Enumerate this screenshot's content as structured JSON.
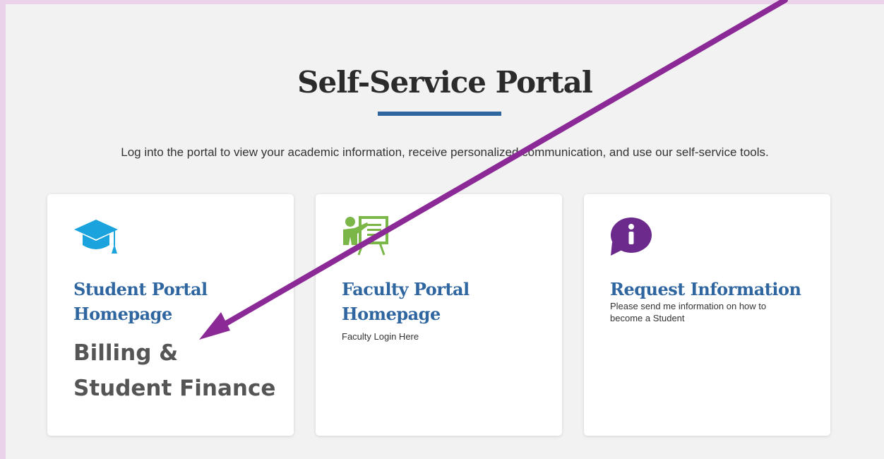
{
  "page": {
    "title": "Self-Service Portal",
    "intro": "Log into the portal to view your academic information, receive personalized communication, and use our self-service tools."
  },
  "cards": [
    {
      "icon": "graduation-cap-icon",
      "heading_line1": "Student Portal",
      "heading_line2": "Homepage",
      "overlay_line1": "Billing &",
      "overlay_line2": "Student Finance"
    },
    {
      "icon": "teacher-board-icon",
      "heading_line1": "Faculty Portal",
      "heading_line2": "Homepage",
      "desc": "Faculty Login Here"
    },
    {
      "icon": "info-chat-icon",
      "heading_line1": "Request Information",
      "desc_line1": "Please send me information on how to",
      "desc_line2": "become a Student"
    }
  ],
  "colors": {
    "accent_blue": "#2f66a0",
    "cap_blue": "#1aa3dc",
    "teacher_green": "#7ab648",
    "info_purple": "#6b2a8c",
    "arrow_purple": "#8b2a96"
  }
}
